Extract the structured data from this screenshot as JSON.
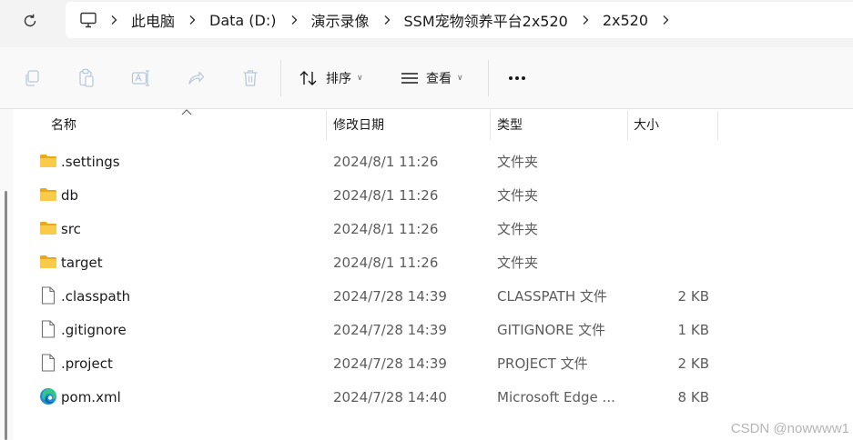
{
  "address_bar": {
    "crumbs": [
      "此电脑",
      "Data (D:)",
      "演示录像",
      "SSM宠物领养平台2x520",
      "2x520"
    ]
  },
  "toolbar": {
    "sort_label": "排序",
    "view_label": "查看"
  },
  "columns": {
    "name": "名称",
    "date": "修改日期",
    "type": "类型",
    "size": "大小"
  },
  "files": [
    {
      "name": ".settings",
      "date": "2024/8/1 11:26",
      "type": "文件夹",
      "size": "",
      "icon": "folder-icon"
    },
    {
      "name": "db",
      "date": "2024/8/1 11:26",
      "type": "文件夹",
      "size": "",
      "icon": "folder-icon"
    },
    {
      "name": "src",
      "date": "2024/8/1 11:26",
      "type": "文件夹",
      "size": "",
      "icon": "folder-icon"
    },
    {
      "name": "target",
      "date": "2024/8/1 11:26",
      "type": "文件夹",
      "size": "",
      "icon": "folder-icon"
    },
    {
      "name": ".classpath",
      "date": "2024/7/28 14:39",
      "type": "CLASSPATH 文件",
      "size": "2 KB",
      "icon": "file-icon"
    },
    {
      "name": ".gitignore",
      "date": "2024/7/28 14:39",
      "type": "GITIGNORE 文件",
      "size": "1 KB",
      "icon": "file-icon"
    },
    {
      "name": ".project",
      "date": "2024/7/28 14:39",
      "type": "PROJECT 文件",
      "size": "2 KB",
      "icon": "file-icon"
    },
    {
      "name": "pom.xml",
      "date": "2024/7/28 14:40",
      "type": "Microsoft Edge ...",
      "size": "8 KB",
      "icon": "edge-icon"
    }
  ],
  "watermark": "CSDN @nowwww1",
  "colors": {
    "folder": "#f4c142",
    "folder_dark": "#e8a91c",
    "edge": "#1c8fd6"
  }
}
